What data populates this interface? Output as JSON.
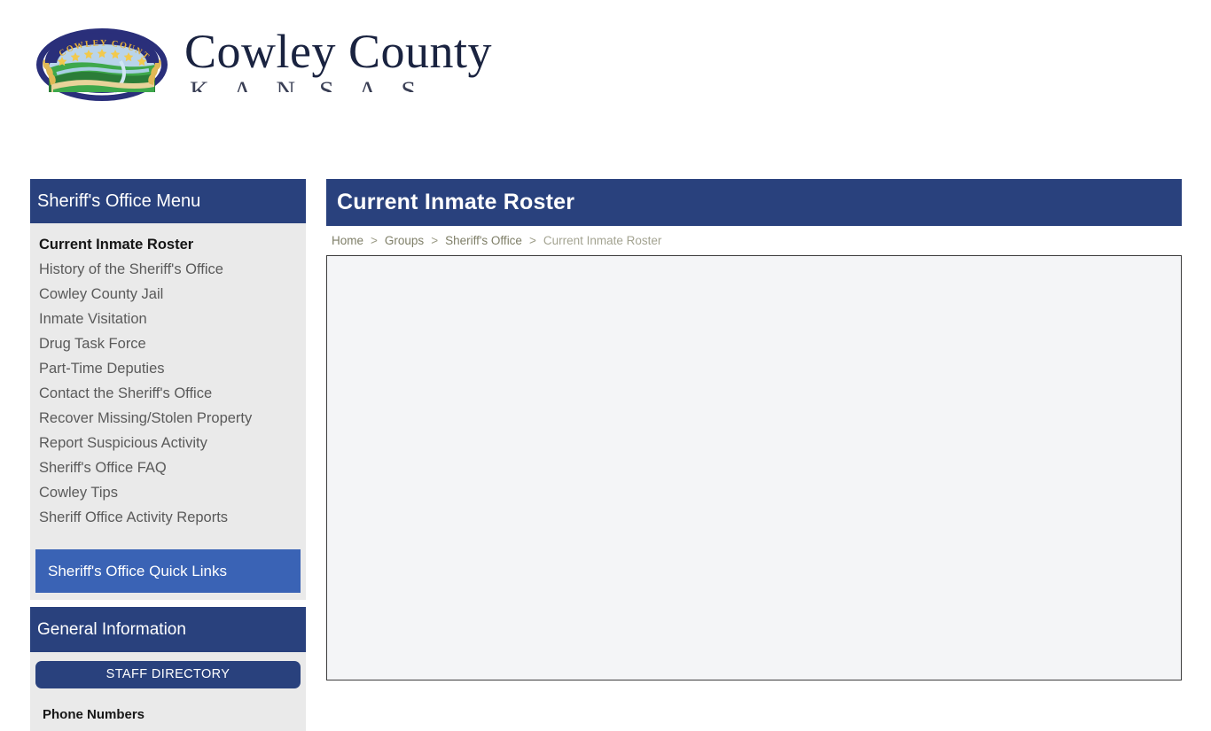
{
  "brand": {
    "title": "Cowley County",
    "subtitle": "KANSAS",
    "seal_text": "COWLEY COUNTY",
    "seal_colors": {
      "ring": "#2a2f7a",
      "text": "#e8b33a",
      "star": "#f2c94c",
      "sky": "#b9d4ea",
      "land": "#3ea84b",
      "land_dark": "#2b7d38",
      "water": "#a8cfe3",
      "wheat": "#e0b855"
    }
  },
  "sidebar": {
    "menu_heading": "Sheriff's Office Menu",
    "items": [
      {
        "label": "Current Inmate Roster",
        "active": true
      },
      {
        "label": "History of the Sheriff's Office",
        "active": false
      },
      {
        "label": "Cowley County Jail",
        "active": false
      },
      {
        "label": "Inmate Visitation",
        "active": false
      },
      {
        "label": "Drug Task Force",
        "active": false
      },
      {
        "label": "Part-Time Deputies",
        "active": false
      },
      {
        "label": "Contact the Sheriff's Office",
        "active": false
      },
      {
        "label": "Recover Missing/Stolen Property",
        "active": false
      },
      {
        "label": "Report Suspicious Activity",
        "active": false
      },
      {
        "label": "Sheriff's Office FAQ",
        "active": false
      },
      {
        "label": "Cowley Tips",
        "active": false
      },
      {
        "label": "Sheriff Office Activity Reports",
        "active": false
      }
    ],
    "quick_links_label": "Sheriff's Office Quick Links",
    "general_info_heading": "General Information",
    "staff_directory_label": "STAFF DIRECTORY",
    "phone_numbers_label": "Phone Numbers"
  },
  "main": {
    "page_title": "Current Inmate Roster",
    "breadcrumb": [
      {
        "label": "Home",
        "current": false
      },
      {
        "label": "Groups",
        "current": false
      },
      {
        "label": "Sheriff's Office",
        "current": false
      },
      {
        "label": "Current Inmate Roster",
        "current": true
      }
    ],
    "breadcrumb_separator": ">",
    "content_body": ""
  },
  "colors": {
    "header_blue": "#29417d",
    "quick_links_blue": "#3a63b5",
    "sidebar_gray": "#eaeaea",
    "content_gray": "#f4f5f7",
    "page_background": "#ffffff"
  }
}
